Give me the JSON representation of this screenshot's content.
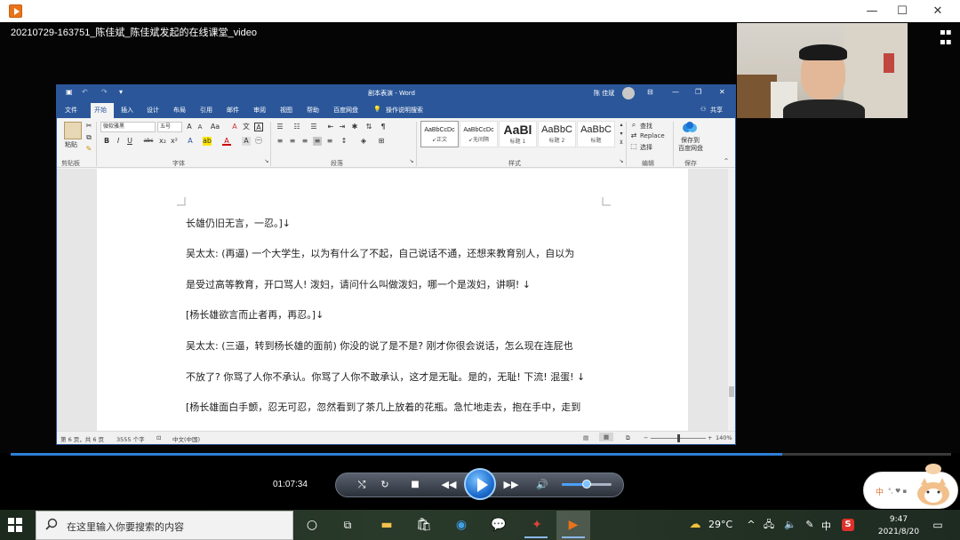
{
  "player": {
    "video_title": "20210729-163751_陈佳斌_陈佳斌发起的在线课堂_video",
    "minimize": "—",
    "maximize": "☐",
    "close": "✕",
    "elapsed": "01:07:34",
    "progress_fraction": 0.82,
    "volume_fraction": 0.5
  },
  "word": {
    "title": "剧本表演 - Word",
    "user": "陈 佳斌",
    "tabs": [
      "文件",
      "开始",
      "插入",
      "设计",
      "布局",
      "引用",
      "邮件",
      "审阅",
      "视图",
      "帮助",
      "百度网盘"
    ],
    "active_tab": "开始",
    "tell_me": "操作说明搜索",
    "share": "共享",
    "ribbon": {
      "paste": "粘贴",
      "clipboard": "剪贴板",
      "font_name": "微软雅黑",
      "font_size": "五号",
      "font_group": "字体",
      "paragraph_group": "段落",
      "styles_group": "样式",
      "editing_group": "编辑",
      "save_group": "保存",
      "find": "查找",
      "replace": "Replace",
      "select": "选择",
      "save_to_baidu_1": "保存到",
      "save_to_baidu_2": "百度网盘",
      "styles": [
        {
          "sample": "AaBbCcDc",
          "name": "↙正文"
        },
        {
          "sample": "AaBbCcDc",
          "name": "↙无间隔"
        },
        {
          "sample": "AaBl",
          "name": "标题 1"
        },
        {
          "sample": "AaBbC",
          "name": "标题 2"
        },
        {
          "sample": "AaBbC",
          "name": "标题"
        }
      ]
    },
    "paragraphs": [
      "长雄仍旧无言，一忍。]↓",
      "吴太太: (再逼) 一个大学生，以为有什么了不起，自己说话不通，还想来教育别人，自以为",
      "是受过高等教育，开口骂人! 泼妇，请问什么叫做泼妇，哪一个是泼妇，讲啊! ↓",
      "[杨长雄欲言而止者再，再忍。]↓",
      "吴太太: (三逼，转到杨长雄的面前) 你没的说了是不是? 刚才你很会说话，怎么现在连屁也",
      "不放了? 你骂了人你不承认。你骂了人你不敢承认，这才是无耻。是的，无耻! 下流! 混蛋! ↓",
      "[杨长雄面白手颤，忍无可忍，忽然看到了茶几上放着的花瓶。急忙地走去，抱在手中，走到"
    ],
    "status": {
      "page": "第 6 页，共 6 页",
      "words": "3555 个字",
      "language": "中文(中国)",
      "zoom": "140%"
    }
  },
  "ime": {
    "label": "中"
  },
  "taskbar": {
    "search_placeholder": "在这里输入你要搜索的内容",
    "weather": "29°C",
    "ime_tray": "中",
    "time": "9:47",
    "date": "2021/8/20"
  }
}
